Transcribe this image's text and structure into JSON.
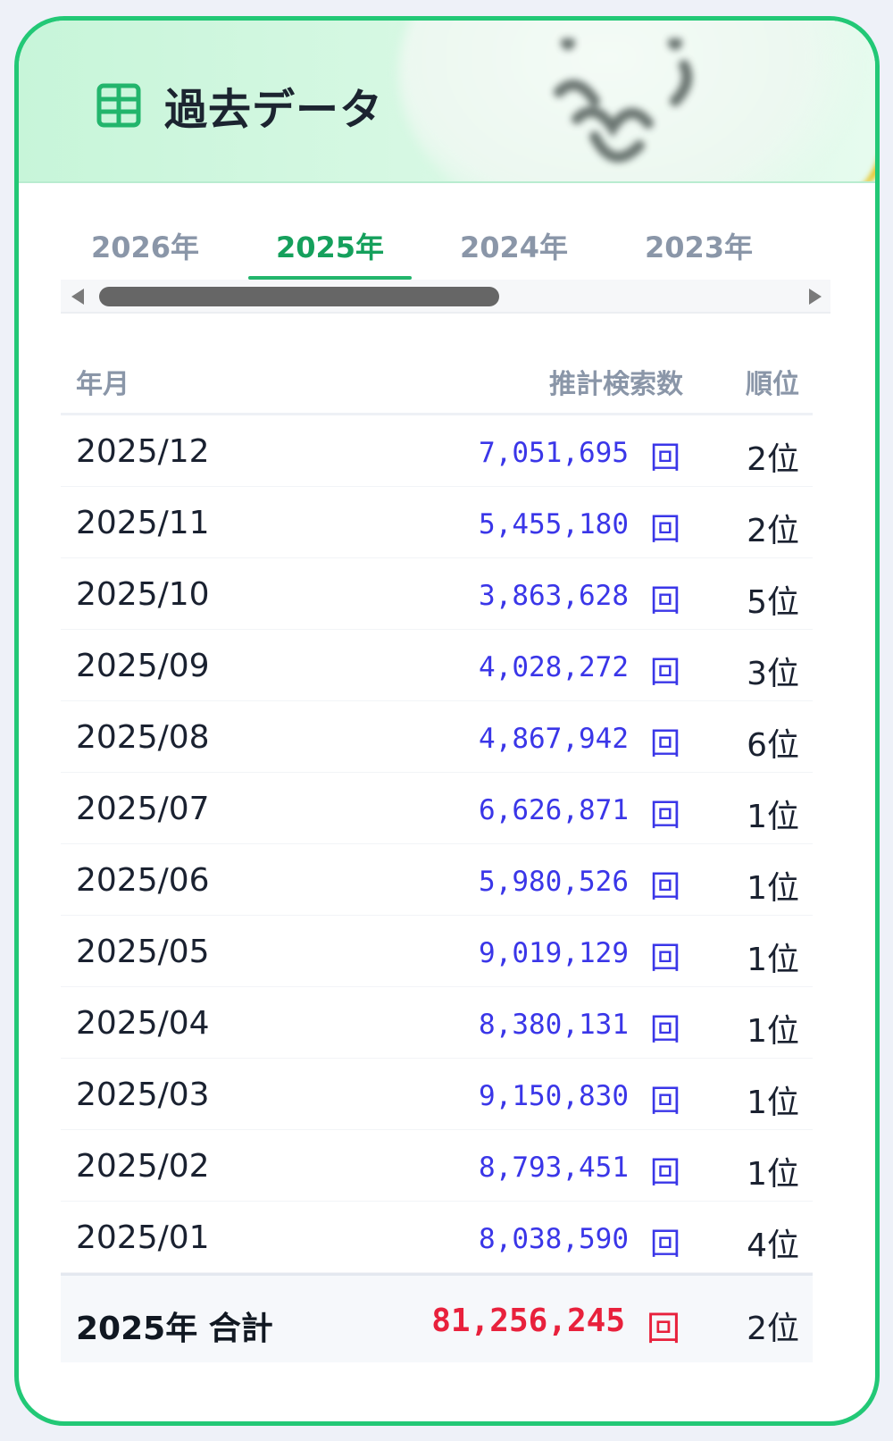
{
  "panel": {
    "title": "過去データ",
    "icon": "table-grid-icon",
    "accent_color": "#22c876"
  },
  "tabs": [
    {
      "label": "2026年",
      "active": false
    },
    {
      "label": "2025年",
      "active": true
    },
    {
      "label": "2024年",
      "active": false
    },
    {
      "label": "2023年",
      "active": false
    }
  ],
  "table": {
    "headers": {
      "month": "年月",
      "count": "推計検索数",
      "rank": "順位"
    },
    "rows": [
      {
        "month": "2025/12",
        "count": "7,051,695",
        "unit": "回",
        "rank": "2位"
      },
      {
        "month": "2025/11",
        "count": "5,455,180",
        "unit": "回",
        "rank": "2位"
      },
      {
        "month": "2025/10",
        "count": "3,863,628",
        "unit": "回",
        "rank": "5位"
      },
      {
        "month": "2025/09",
        "count": "4,028,272",
        "unit": "回",
        "rank": "3位"
      },
      {
        "month": "2025/08",
        "count": "4,867,942",
        "unit": "回",
        "rank": "6位"
      },
      {
        "month": "2025/07",
        "count": "6,626,871",
        "unit": "回",
        "rank": "1位"
      },
      {
        "month": "2025/06",
        "count": "5,980,526",
        "unit": "回",
        "rank": "1位"
      },
      {
        "month": "2025/05",
        "count": "9,019,129",
        "unit": "回",
        "rank": "1位"
      },
      {
        "month": "2025/04",
        "count": "8,380,131",
        "unit": "回",
        "rank": "1位"
      },
      {
        "month": "2025/03",
        "count": "9,150,830",
        "unit": "回",
        "rank": "1位"
      },
      {
        "month": "2025/02",
        "count": "8,793,451",
        "unit": "回",
        "rank": "1位"
      },
      {
        "month": "2025/01",
        "count": "8,038,590",
        "unit": "回",
        "rank": "4位"
      }
    ],
    "total": {
      "label": "2025年 合計",
      "count": "81,256,245",
      "unit": "回",
      "rank": "2位"
    }
  }
}
